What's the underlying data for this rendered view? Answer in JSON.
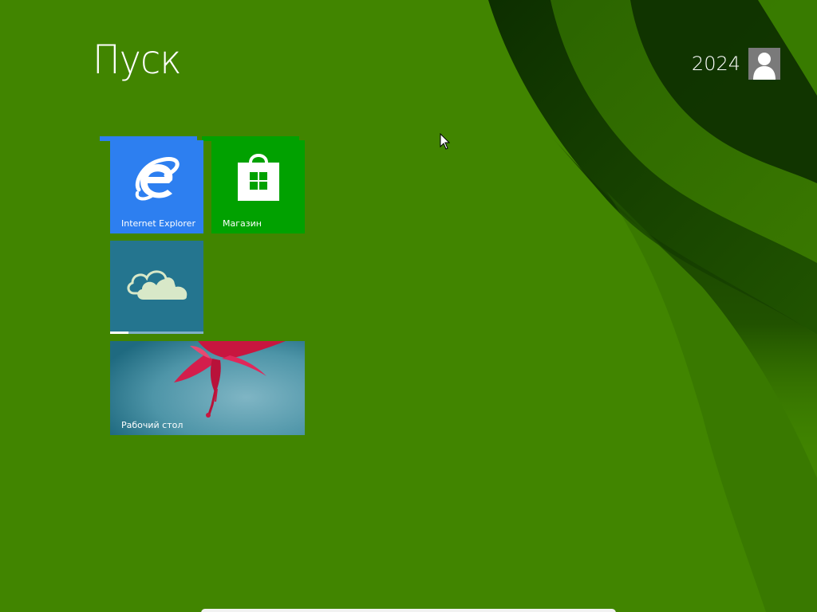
{
  "start": {
    "title": "Пуск"
  },
  "user": {
    "name": "2024",
    "avatar_icon": "user-silhouette-icon"
  },
  "tiles": [
    {
      "id": "internet-explorer",
      "label": "Internet Explorer",
      "icon": "internet-explorer-icon",
      "color": "#2d7ff0"
    },
    {
      "id": "store",
      "label": "Магазин",
      "icon": "store-bag-icon",
      "color": "#01a100"
    },
    {
      "id": "onedrive",
      "label": "",
      "icon": "cloud-icon",
      "color": "#24758f",
      "progress": 0.2
    },
    {
      "id": "desktop",
      "label": "Рабочий стол",
      "icon": "flower-wallpaper",
      "color": "#3d8aa0"
    }
  ],
  "colors": {
    "background": "#418500",
    "swirl_dark": "#1e4a00"
  }
}
